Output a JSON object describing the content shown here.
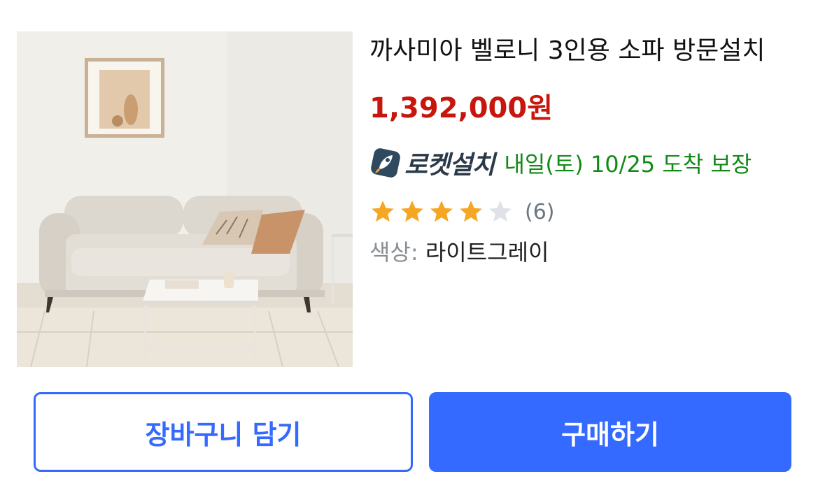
{
  "product": {
    "title": "까사미아 벨로니 3인용 소파 방문설치",
    "price": "1,392,000원",
    "delivery": {
      "badge_label": "로켓설치",
      "badge_icon": "rocket-icon",
      "text": "내일(토) 10/25 도착 보장",
      "color": "#128a16"
    },
    "rating": {
      "stars_filled": 4,
      "stars_total": 5,
      "review_count": "(6)",
      "star_color": "#f5a623",
      "empty_star_color": "#dfe3e8"
    },
    "option": {
      "label": "색상:",
      "value": "라이트그레이"
    },
    "image_alt": "sofa-product-photo"
  },
  "actions": {
    "cart_label": "장바구니 담기",
    "buy_label": "구매하기",
    "accent_color": "#346aff"
  },
  "colors": {
    "price": "#c8160d"
  }
}
